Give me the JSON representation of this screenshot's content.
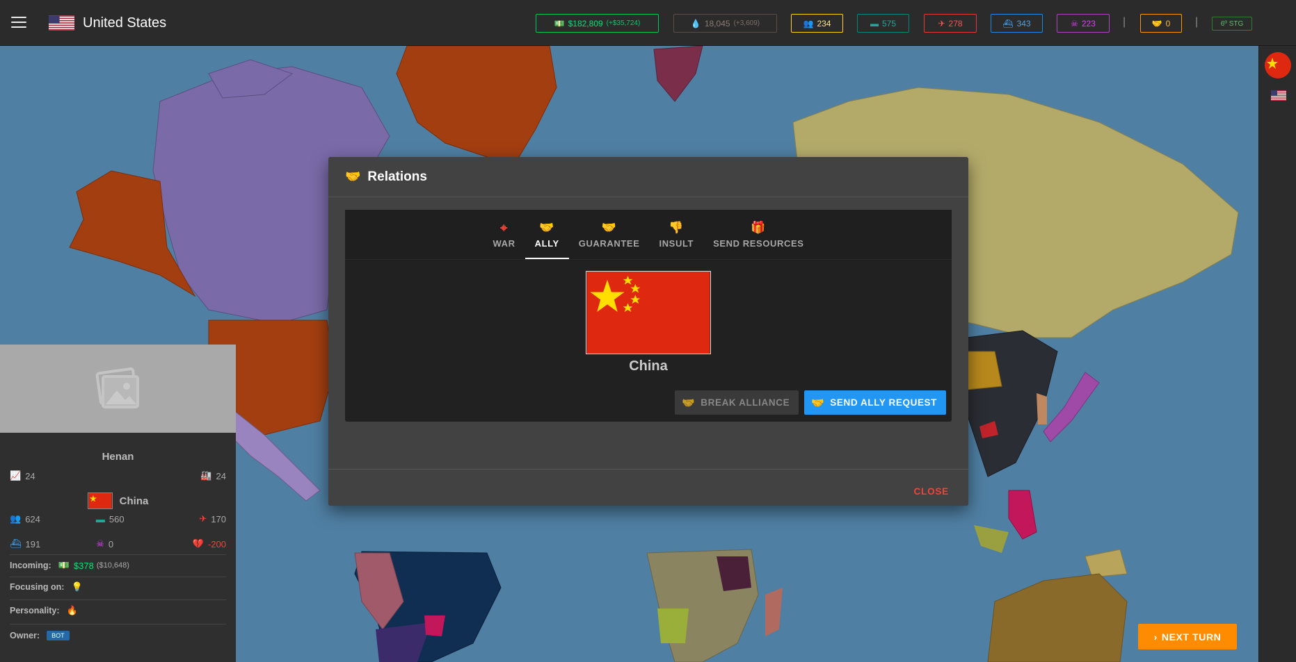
{
  "header": {
    "country": "United States",
    "stats": {
      "money": "$182,809",
      "money_delta": "(+$35,724)",
      "oil": "18,045",
      "oil_delta": "(+3,609)",
      "manpower": "234",
      "tanks": "575",
      "aircraft": "278",
      "ships": "343",
      "nukes": "223",
      "alliances": "0",
      "stg": "6º STG"
    }
  },
  "modal": {
    "title": "Relations",
    "tabs": [
      {
        "label": "WAR",
        "color": "#f44336"
      },
      {
        "label": "ALLY",
        "color": "#2196f3"
      },
      {
        "label": "GUARANTEE",
        "color": "#26a69a"
      },
      {
        "label": "INSULT",
        "color": "#ff5722"
      },
      {
        "label": "SEND RESOURCES",
        "color": "#00e676"
      }
    ],
    "active_tab": "ALLY",
    "target_country": "China",
    "break_label": "BREAK ALLIANCE",
    "send_label": "SEND ALLY REQUEST",
    "close_label": "CLOSE"
  },
  "province_panel": {
    "province": "Henan",
    "growth": "24",
    "industry": "24",
    "owner_country": "China",
    "manpower": "624",
    "tanks": "560",
    "aircraft": "170",
    "ships": "191",
    "nukes": "0",
    "relation": "-200",
    "incoming_label": "Incoming:",
    "incoming": "$378",
    "incoming_sub": "($10,648)",
    "focusing_label": "Focusing on:",
    "personality_label": "Personality:",
    "owner_label": "Owner:",
    "owner_badge": "BOT"
  },
  "next_turn_label": "NEXT TURN"
}
